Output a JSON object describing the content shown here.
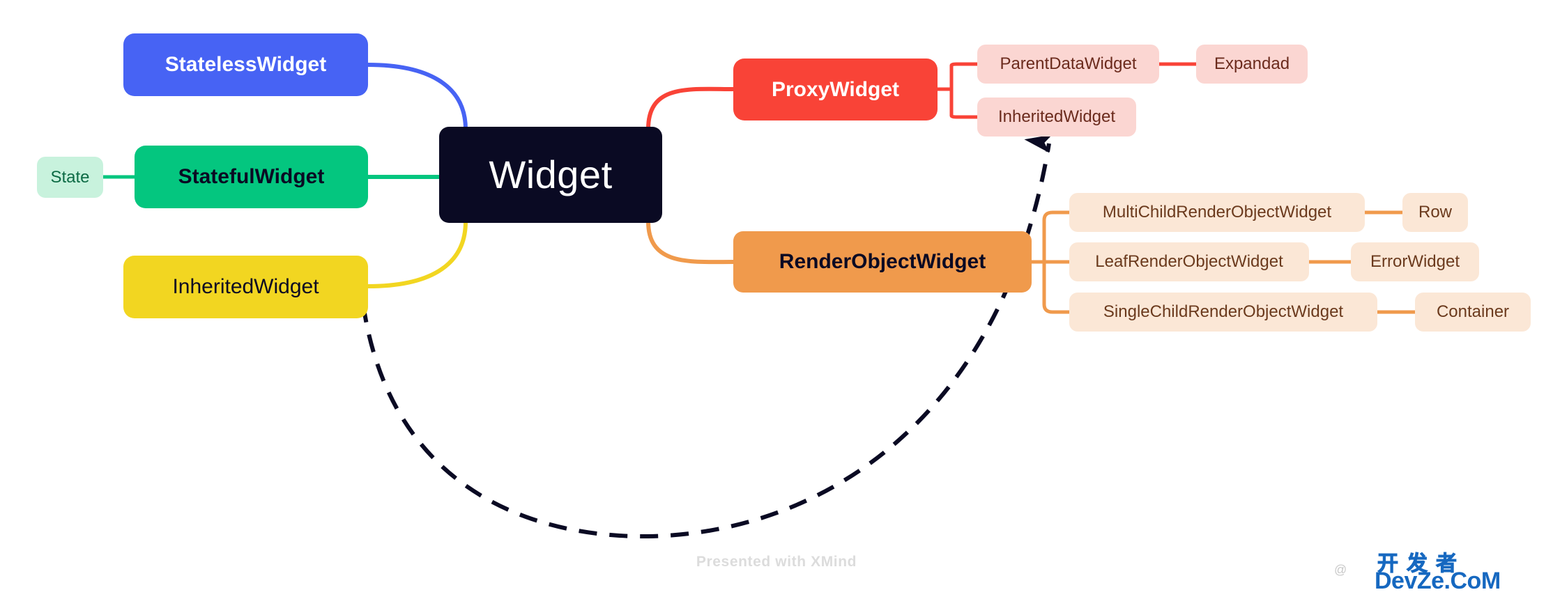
{
  "diagram": {
    "title": "Flutter Widget hierarchy mind map",
    "root": {
      "label": "Widget"
    },
    "left_branch": [
      {
        "label": "StatelessWidget",
        "color": "#4763f4"
      },
      {
        "label": "StatefulWidget",
        "color": "#04c67f",
        "child": {
          "label": "State",
          "color": "#c8f2dd"
        }
      },
      {
        "label": "InheritedWidget",
        "color": "#f2d621"
      }
    ],
    "right_branch": [
      {
        "label": "ProxyWidget",
        "color": "#f94337",
        "children": [
          {
            "label": "ParentDataWidget",
            "color": "#fbd6d2",
            "child": {
              "label": "Expandad",
              "color": "#fbd6d2"
            }
          },
          {
            "label": "InheritedWidget",
            "color": "#fbd6d2"
          }
        ]
      },
      {
        "label": "RenderObjectWidget",
        "color": "#f09a4c",
        "children": [
          {
            "label": "MultiChildRenderObjectWidget",
            "color": "#fbe7d6",
            "child": {
              "label": "Row",
              "color": "#fbe7d6"
            }
          },
          {
            "label": "LeafRenderObjectWidget",
            "color": "#fbe7d6",
            "child": {
              "label": "ErrorWidget",
              "color": "#fbe7d6"
            }
          },
          {
            "label": "SingleChildRenderObjectWidget",
            "color": "#fbe7d6",
            "child": {
              "label": "Container",
              "color": "#fbe7d6"
            }
          }
        ]
      }
    ],
    "relationship_arrow": {
      "from": "InheritedWidget (left branch)",
      "to": "InheritedWidget (under ProxyWidget)",
      "style": "dashed",
      "color": "#0a0a23"
    }
  },
  "footer": {
    "label": "Presented with XMind"
  },
  "watermark": {
    "handle": "@",
    "chinese": "开发者",
    "site": "DevZe.CoM",
    "color": "#1668c0"
  },
  "colors": {
    "root_bg": "#0a0a23",
    "stateless": "#4763f4",
    "stateful": "#04c67f",
    "state": "#c8f2dd",
    "inherited_yellow": "#f2d621",
    "proxy_red": "#f94337",
    "pink_leaf": "#fbd6d2",
    "render_orange": "#f09a4c",
    "peach_leaf": "#fbe7d6",
    "dashed_arrow": "#0a0a23",
    "footer_text": "#dcdcdc"
  }
}
